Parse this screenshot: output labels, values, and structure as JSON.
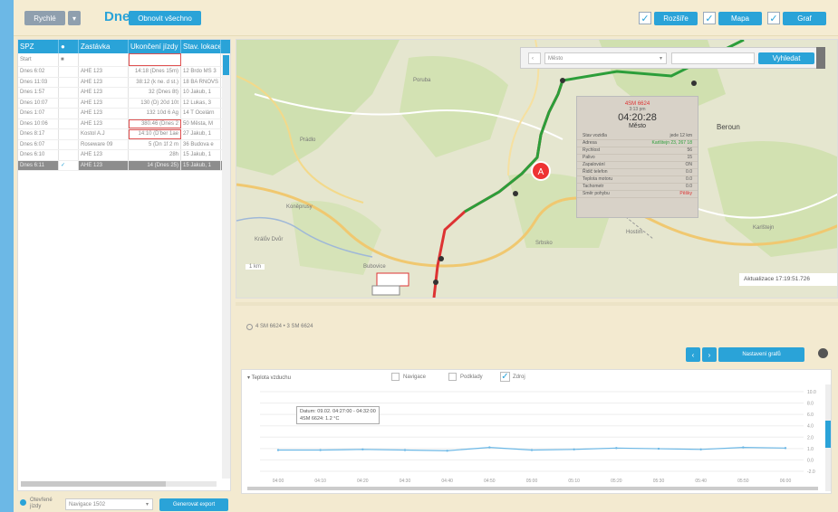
{
  "topbar": {
    "combo_value": "Rychlé",
    "title": "Dnes",
    "refresh_label": "Obnovit všechno",
    "right_buttons": [
      {
        "label": "Rozšíře",
        "checked": true
      },
      {
        "label": "Mapa",
        "checked": true
      },
      {
        "label": "Graf",
        "checked": true
      }
    ]
  },
  "table": {
    "headers": [
      "SPZ",
      "",
      "Zastávka",
      "Ukončení jízdy",
      "Stav. lokace"
    ],
    "filter_value": "Start",
    "rows": [
      {
        "id": "Dnes 6:02",
        "stop": "AHE 123",
        "end": "14:18 (Dnes 15m)",
        "loc": "12 Brdo MS 3"
      },
      {
        "id": "Dnes 11:03",
        "stop": "AHE 123",
        "end": "38:12 (k ne. d st.)",
        "loc": "18 BA RNOVS"
      },
      {
        "id": "Dnes 1:57",
        "stop": "AHE 123",
        "end": "32 (Dnes 8t)",
        "loc": "10 Jakub, 1"
      },
      {
        "id": "Dnes 10:07",
        "stop": "AHE 123",
        "end": "130 (D) 20d 10t",
        "loc": "12 Lukas, 3"
      },
      {
        "id": "Dnes 1:07",
        "stop": "AHE 123",
        "end": "132 10d 6 Ag",
        "loc": "14 T Ocelárn"
      },
      {
        "id": "Dnes 10:06",
        "stop": "AHE 123",
        "end": "380.46 (Dnes 2",
        "loc": "50 Města, M"
      },
      {
        "id": "Dnes 8:17",
        "stop": "Kostol A.J",
        "end": "14:10 (D'ber 1ae",
        "loc": "27 Jakub, 1"
      },
      {
        "id": "Dnes 6:07",
        "stop": "Roseware 09",
        "end": "5 (Dn 1f 2 m",
        "loc": "36 Budova e"
      },
      {
        "id": "Dnes 6:10",
        "stop": "AHE 123",
        "end": "28h",
        "loc": "15 Jakub, 1"
      },
      {
        "id": "Dnes 6:11",
        "stop": "AHE 123",
        "end": "14 (Dnes 25)",
        "loc": "15 Jakub, 1"
      }
    ]
  },
  "bottombar": {
    "radio_label": "Otevřené jízdy",
    "select_value": "Navigace 1502",
    "export_label": "Generovat export"
  },
  "map": {
    "search_placeholder": "Město",
    "search_button": "Vyhledat",
    "labels": [
      "Poruba",
      "Prádlo",
      "Koněprusy",
      "Králův Dvůr",
      "Bubovice",
      "Srbsko",
      "Hostim",
      "Karlštejn",
      "Beroun"
    ],
    "scale_label": "1 km",
    "stamp_label": "Aktualizace 17:19:51.726",
    "popup": {
      "plate": "4SM 6624",
      "sub": "3:13 pm",
      "time": "04:20:28",
      "place": "Město",
      "rows": [
        {
          "k": "Stav vozidla",
          "v": "jede 12 km"
        },
        {
          "k": "Adresa",
          "v": "Karlštejn 23, 267 18"
        },
        {
          "k": "Rychlost",
          "v": "56"
        },
        {
          "k": "Palivo",
          "v": "15"
        },
        {
          "k": "Zapalování",
          "v": "ON"
        },
        {
          "k": "Řidič telefon",
          "v": "0.0"
        },
        {
          "k": "Teplota motoru",
          "v": "0.0"
        },
        {
          "k": "Tachometr",
          "v": "0.0"
        },
        {
          "k": "Směr pohybu",
          "v": "Pěšky"
        }
      ]
    }
  },
  "lower": {
    "legend_text": "4 SM 6624 • 3 SM 6624",
    "nav_buttons": [
      "‹",
      "›"
    ],
    "main_button": "Nastavení grafů"
  },
  "chart": {
    "series_select": "Teplota vzduchu",
    "toggles": [
      {
        "label": "Navigace",
        "checked": false
      },
      {
        "label": "Podklady",
        "checked": false
      },
      {
        "label": "Zdroj",
        "checked": true
      }
    ],
    "tooltip_line1": "Datum: 09.02. 04:27:00 - 04:32:00",
    "tooltip_line2": "4SM 6624: 1.2 °C"
  },
  "chart_data": {
    "type": "line",
    "x": [
      "04:00",
      "04:10",
      "04:20",
      "04:30",
      "04:40",
      "04:50",
      "05:00",
      "05:10",
      "05:20",
      "05:30",
      "05:40",
      "05:50",
      "06:00"
    ],
    "series": [
      {
        "name": "4SM 6624",
        "values": [
          1.2,
          1.2,
          1.3,
          1.2,
          1.1,
          1.6,
          1.2,
          1.3,
          1.5,
          1.4,
          1.3,
          1.6,
          1.5
        ]
      }
    ],
    "y_ticks": [
      "10.0",
      "8.0",
      "6.0",
      "4.0",
      "2.0",
      "1.0",
      "0.0",
      "-2.0"
    ],
    "ylim": [
      -2,
      10
    ],
    "colors": {
      "line": "#6cb8e6"
    }
  }
}
